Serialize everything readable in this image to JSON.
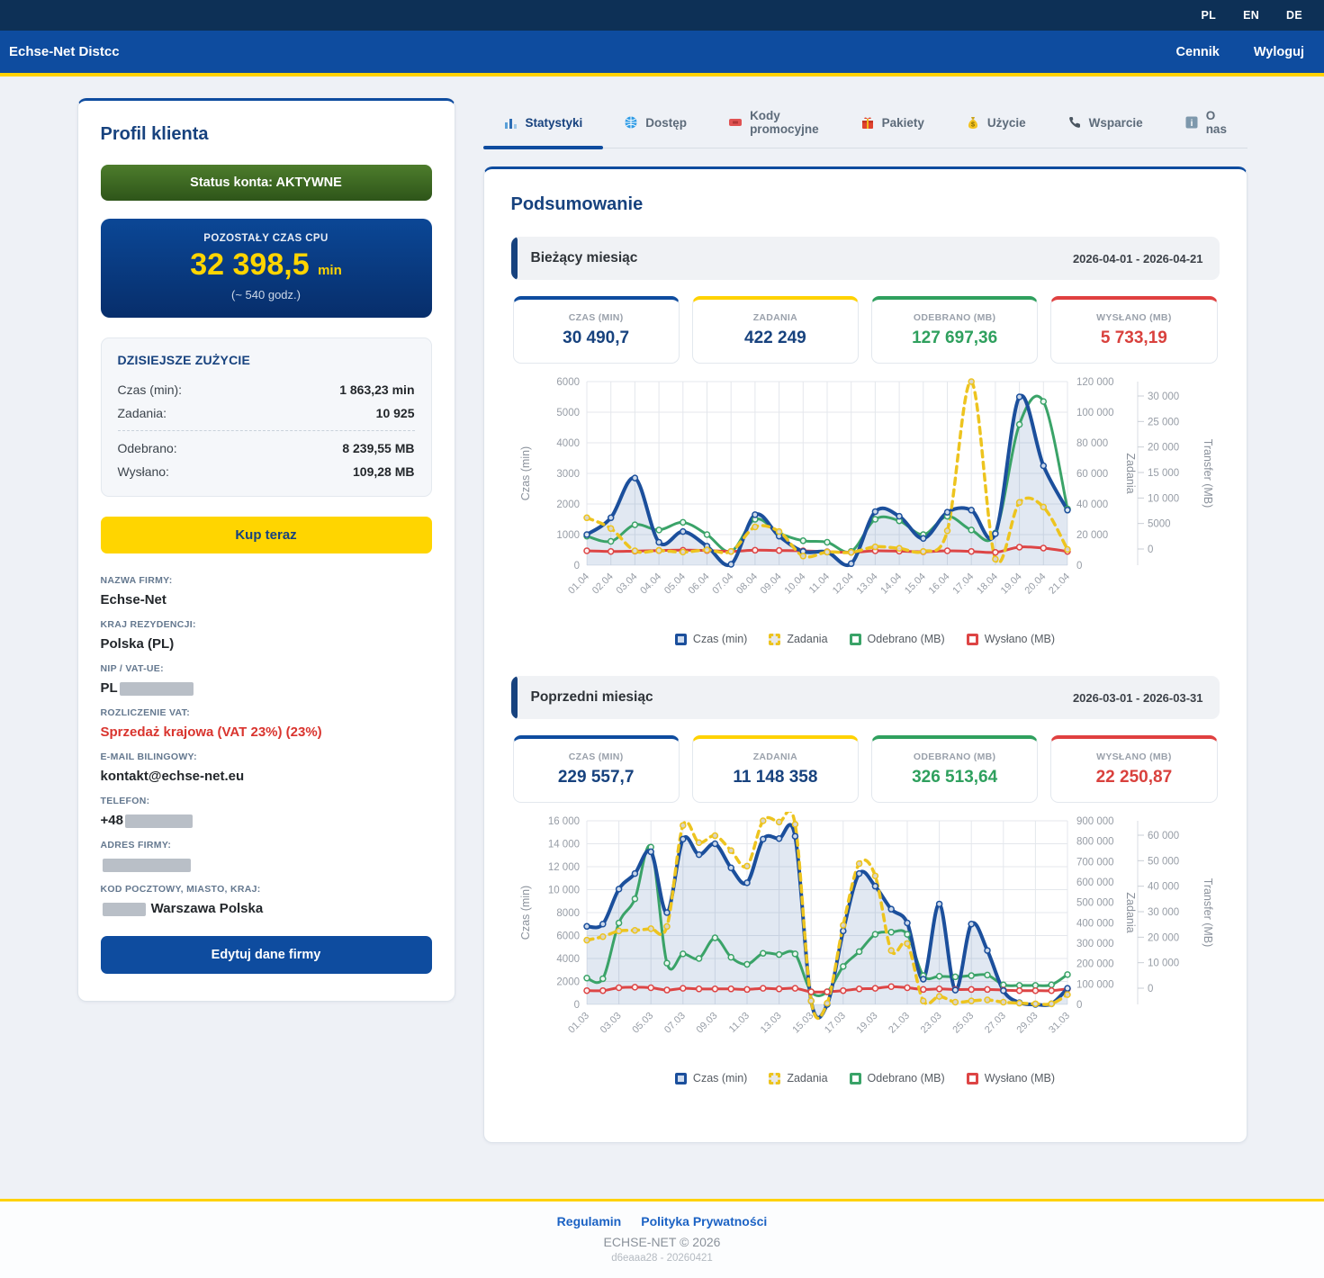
{
  "top_bar": {
    "languages": [
      "PL",
      "EN",
      "DE"
    ]
  },
  "header": {
    "brand": "Echse-Net Distcc",
    "links": [
      "Cennik",
      "Wyloguj"
    ]
  },
  "profile": {
    "title": "Profil klienta",
    "status_label": "Status konta: AKTYWNE",
    "cpu": {
      "label": "POZOSTAŁY CZAS CPU",
      "value": "32 398,5",
      "unit": "min",
      "sub": "(~ 540 godz.)"
    },
    "today": {
      "title": "DZISIEJSZE ZUŻYCIE",
      "rows": [
        {
          "label": "Czas (min):",
          "value": "1 863,23 min"
        },
        {
          "label": "Zadania:",
          "value": "10 925"
        },
        {
          "label": "Odebrano:",
          "value": "8 239,55 MB"
        },
        {
          "label": "Wysłano:",
          "value": "109,28 MB"
        }
      ],
      "separator_after_row": 1
    },
    "buy_button": "Kup teraz",
    "fields": [
      {
        "key": "company-name",
        "label": "NAZWA FIRMY:",
        "value": "Echse-Net"
      },
      {
        "key": "residence-country",
        "label": "KRAJ REZYDENCJI:",
        "value": "Polska (PL)"
      },
      {
        "key": "nip-vat",
        "label": "NIP / VAT-UE:",
        "value": "PL",
        "redact": "after",
        "redact_width": 82
      },
      {
        "key": "vat-settlement",
        "label": "ROZLICZENIE VAT:",
        "value": "Sprzedaż krajowa (VAT 23%) (23%)",
        "highlight": "red"
      },
      {
        "key": "billing-email",
        "label": "E-MAIL BILINGOWY:",
        "value": "kontakt@echse-net.eu"
      },
      {
        "key": "phone",
        "label": "TELEFON:",
        "value": "+48",
        "redact": "after",
        "redact_width": 75
      },
      {
        "key": "company-address",
        "label": "ADRES FIRMY:",
        "value": "",
        "redact": "only",
        "redact_width": 98
      },
      {
        "key": "postal-city-country",
        "label": "KOD POCZTOWY, MIASTO, KRAJ:",
        "value": "Warszawa Polska",
        "redact": "before",
        "redact_width": 48
      }
    ],
    "edit_button": "Edytuj dane firmy"
  },
  "tabs": [
    {
      "label": "Statystyki",
      "icon": "bar-chart",
      "active": true
    },
    {
      "label": "Dostęp",
      "icon": "globe",
      "active": false
    },
    {
      "label": "Kody promocyjne",
      "icon": "coupon",
      "active": false
    },
    {
      "label": "Pakiety",
      "icon": "gift",
      "active": false
    },
    {
      "label": "Użycie",
      "icon": "money-bag",
      "active": false
    },
    {
      "label": "Wsparcie",
      "icon": "phone",
      "active": false
    },
    {
      "label": "O nas",
      "icon": "info",
      "active": false
    }
  ],
  "main": {
    "title": "Podsumowanie",
    "sections": [
      {
        "key": "current-month",
        "title": "Bieżący miesiąc",
        "date_range": "2026-04-01 - 2026-04-21",
        "stats": [
          {
            "label": "CZAS (MIN)",
            "value": "30 490,7",
            "color": "#17427e",
            "border": "#0e4c9f"
          },
          {
            "label": "ZADANIA",
            "value": "422 249",
            "color": "#17427e",
            "border": "#ffd200"
          },
          {
            "label": "ODEBRANO (MB)",
            "value": "127 697,36",
            "color": "#2fa05e",
            "border": "#2fa05e"
          },
          {
            "label": "WYSŁANO (MB)",
            "value": "5 733,19",
            "color": "#d9413d",
            "border": "#e04040"
          }
        ],
        "chart_index": 0
      },
      {
        "key": "previous-month",
        "title": "Poprzedni miesiąc",
        "date_range": "2026-03-01 - 2026-03-31",
        "stats": [
          {
            "label": "CZAS (MIN)",
            "value": "229 557,7",
            "color": "#17427e",
            "border": "#0e4c9f"
          },
          {
            "label": "ZADANIA",
            "value": "11 148 358",
            "color": "#17427e",
            "border": "#ffd200"
          },
          {
            "label": "ODEBRANO (MB)",
            "value": "326 513,64",
            "color": "#2fa05e",
            "border": "#2fa05e"
          },
          {
            "label": "WYSŁANO (MB)",
            "value": "22 250,87",
            "color": "#d9413d",
            "border": "#e04040"
          }
        ],
        "chart_index": 1
      }
    ]
  },
  "chart_data": [
    {
      "type": "line",
      "x_labels": [
        "01.04",
        "02.04",
        "03.04",
        "04.04",
        "05.04",
        "06.04",
        "07.04",
        "08.04",
        "09.04",
        "10.04",
        "11.04",
        "12.04",
        "13.04",
        "14.04",
        "15.04",
        "16.04",
        "17.04",
        "18.04",
        "19.04",
        "20.04",
        "21.04"
      ],
      "label_step": 1,
      "axes": {
        "left": {
          "title": "Czas (min)",
          "max": 6000,
          "ticks": [
            "6000",
            "5000",
            "4000",
            "3000",
            "2000",
            "1000",
            "0"
          ]
        },
        "right1": {
          "title": "Zadania",
          "max": 120000,
          "ticks": [
            "120 000",
            "100 000",
            "80 000",
            "60 000",
            "40 000",
            "20 000",
            "0"
          ]
        },
        "right2": {
          "title": "Transfer (MB)",
          "max": 30000,
          "ticks": [
            "30 000",
            "25 000",
            "20 000",
            "15 000",
            "10 000",
            "5000",
            "0"
          ]
        }
      },
      "series": [
        {
          "name": "Czas (min)",
          "axis": "left",
          "style": "area",
          "color": "#1b4f9c",
          "point_fill": "#dfe7f3",
          "values": [
            1000,
            1550,
            2850,
            750,
            1100,
            620,
            30,
            1650,
            950,
            450,
            430,
            50,
            1750,
            1600,
            875,
            1730,
            1800,
            1030,
            5500,
            3250,
            1800
          ]
        },
        {
          "name": "Zadania",
          "axis": "right1",
          "style": "dashed",
          "color": "#edc41f",
          "point_fill": "#d6d6d6",
          "values": [
            31000,
            24000,
            9400,
            9600,
            8600,
            10000,
            9000,
            25000,
            22000,
            6000,
            8600,
            8400,
            12000,
            11000,
            9000,
            22500,
            120000,
            4000,
            41000,
            38000,
            10300
          ]
        },
        {
          "name": "Odebrano (MB)",
          "axis": "right2",
          "style": "line",
          "color": "#3aa368",
          "point_fill": "#ffffff",
          "values": [
            4750,
            3900,
            6600,
            5750,
            7000,
            5000,
            2250,
            7500,
            5250,
            4000,
            3750,
            2250,
            7500,
            7250,
            5000,
            8000,
            5750,
            5250,
            23000,
            26750,
            9200
          ]
        },
        {
          "name": "Wysłano (MB)",
          "axis": "right2",
          "style": "line",
          "color": "#dd4545",
          "point_fill": "#ffffff",
          "values": [
            2350,
            2250,
            2300,
            2400,
            2450,
            2400,
            2250,
            2450,
            2400,
            2350,
            2200,
            2100,
            2350,
            2300,
            2200,
            2350,
            2250,
            2100,
            2950,
            2800,
            2250
          ]
        }
      ],
      "legend": [
        "Czas (min)",
        "Zadania",
        "Odebrano (MB)",
        "Wysłano (MB)"
      ]
    },
    {
      "type": "line",
      "x_labels": [
        "01.03",
        "02.03",
        "03.03",
        "04.03",
        "05.03",
        "06.03",
        "07.03",
        "08.03",
        "09.03",
        "10.03",
        "11.03",
        "12.03",
        "13.03",
        "14.03",
        "15.03",
        "16.03",
        "17.03",
        "18.03",
        "19.03",
        "20.03",
        "21.03",
        "22.03",
        "23.03",
        "24.03",
        "25.03",
        "26.03",
        "27.03",
        "28.03",
        "29.03",
        "30.03",
        "31.03"
      ],
      "label_step": 2,
      "axes": {
        "left": {
          "title": "Czas (min)",
          "max": 16000,
          "ticks": [
            "16 000",
            "14 000",
            "12 000",
            "10 000",
            "8000",
            "6000",
            "4000",
            "2000",
            "0"
          ]
        },
        "right1": {
          "title": "Zadania",
          "max": 900000,
          "ticks": [
            "900 000",
            "800 000",
            "700 000",
            "600 000",
            "500 000",
            "400 000",
            "300 000",
            "200 000",
            "100 000",
            "0"
          ]
        },
        "right2": {
          "title": "Transfer (MB)",
          "max": 60000,
          "ticks": [
            "60 000",
            "50 000",
            "40 000",
            "30 000",
            "20 000",
            "10 000",
            "0"
          ]
        }
      },
      "series": [
        {
          "name": "Czas (min)",
          "axis": "left",
          "style": "area",
          "color": "#1b4f9c",
          "point_fill": "#dfe7f3",
          "values": [
            6800,
            7000,
            10050,
            11400,
            13300,
            8000,
            14400,
            13050,
            14000,
            11900,
            10600,
            14400,
            14450,
            14650,
            300,
            0,
            6400,
            11400,
            10300,
            8300,
            7100,
            2200,
            8750,
            1250,
            7000,
            4700,
            1200,
            150,
            0,
            50,
            1400
          ]
        },
        {
          "name": "Zadania",
          "axis": "right1",
          "style": "dashed",
          "color": "#edc41f",
          "point_fill": "#d6d6d6",
          "values": [
            315000,
            332000,
            360000,
            363000,
            371000,
            382000,
            877000,
            793000,
            827000,
            754000,
            678000,
            900000,
            894000,
            883000,
            17000,
            6000,
            388000,
            690000,
            630000,
            264000,
            298000,
            17000,
            39000,
            11000,
            17000,
            22000,
            11000,
            6000,
            3000,
            3000,
            48000
          ]
        },
        {
          "name": "Odebrano (MB)",
          "axis": "right2",
          "style": "line",
          "color": "#3aa368",
          "point_fill": "#ffffff",
          "values": [
            8600,
            8400,
            26600,
            34500,
            51400,
            13500,
            16500,
            15000,
            21750,
            15400,
            13100,
            16700,
            16300,
            16500,
            4100,
            4100,
            12400,
            17250,
            22900,
            23600,
            22900,
            9400,
            9200,
            9000,
            9400,
            9600,
            6400,
            6200,
            6200,
            6400,
            9750
          ]
        },
        {
          "name": "Wysłano (MB)",
          "axis": "right2",
          "style": "line",
          "color": "#dd4545",
          "point_fill": "#ffffff",
          "values": [
            4500,
            4500,
            5440,
            5625,
            5440,
            4690,
            5250,
            5060,
            5060,
            5060,
            4875,
            5250,
            5060,
            5250,
            4125,
            4125,
            4500,
            5060,
            5250,
            5810,
            5440,
            4875,
            5060,
            4875,
            4875,
            4875,
            4690,
            4500,
            4500,
            4500,
            5060
          ]
        }
      ],
      "legend": [
        "Czas (min)",
        "Zadania",
        "Odebrano (MB)",
        "Wysłano (MB)"
      ]
    }
  ],
  "footer": {
    "links": [
      "Regulamin",
      "Polityka Prywatności"
    ],
    "copyright": "ECHSE-NET © 2026",
    "build": "d6eaaa28 - 20260421"
  },
  "colors": {
    "navy": "#0d3056",
    "accent_blue": "#0e4c9f",
    "accent_yellow": "#ffd200",
    "title_blue": "#17427e",
    "green": "#2fa05e",
    "red": "#d9413d"
  }
}
